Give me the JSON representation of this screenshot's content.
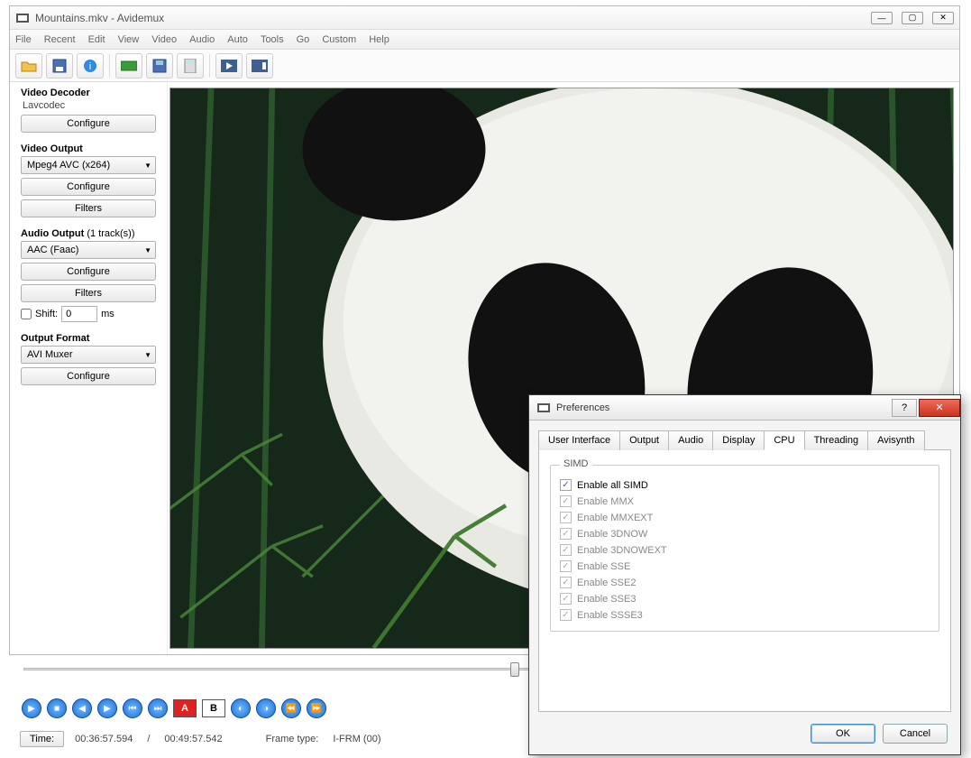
{
  "window": {
    "title": "Mountains.mkv - Avidemux"
  },
  "menu": [
    "File",
    "Recent",
    "Edit",
    "View",
    "Video",
    "Audio",
    "Auto",
    "Tools",
    "Go",
    "Custom",
    "Help"
  ],
  "sidebar": {
    "video_decoder": {
      "title": "Video Decoder",
      "codec": "Lavcodec",
      "configure": "Configure"
    },
    "video_output": {
      "title": "Video Output",
      "value": "Mpeg4 AVC (x264)",
      "configure": "Configure",
      "filters": "Filters"
    },
    "audio_output": {
      "title": "Audio Output",
      "trackinfo": "(1 track(s))",
      "value": "AAC (Faac)",
      "configure": "Configure",
      "filters": "Filters",
      "shift_label": "Shift:",
      "shift_value": "0",
      "shift_unit": "ms"
    },
    "output_format": {
      "title": "Output Format",
      "value": "AVI Muxer",
      "configure": "Configure"
    }
  },
  "timebar": {
    "time_label": "Time:",
    "current": "00:36:57.594",
    "sep": "/",
    "total": "00:49:57.542",
    "frametype_label": "Frame type:",
    "frametype_value": "I-FRM (00)"
  },
  "prefs": {
    "title": "Preferences",
    "tabs": [
      "User Interface",
      "Output",
      "Audio",
      "Display",
      "CPU",
      "Threading",
      "Avisynth"
    ],
    "active_tab": "CPU",
    "group": "SIMD",
    "options": [
      {
        "label": "Enable all SIMD",
        "checked": true,
        "enabled": true
      },
      {
        "label": "Enable MMX",
        "checked": true,
        "enabled": false
      },
      {
        "label": "Enable MMXEXT",
        "checked": true,
        "enabled": false
      },
      {
        "label": "Enable 3DNOW",
        "checked": true,
        "enabled": false
      },
      {
        "label": "Enable 3DNOWEXT",
        "checked": true,
        "enabled": false
      },
      {
        "label": "Enable SSE",
        "checked": true,
        "enabled": false
      },
      {
        "label": "Enable SSE2",
        "checked": true,
        "enabled": false
      },
      {
        "label": "Enable SSE3",
        "checked": true,
        "enabled": false
      },
      {
        "label": "Enable SSSE3",
        "checked": true,
        "enabled": false
      }
    ],
    "ok": "OK",
    "cancel": "Cancel"
  }
}
